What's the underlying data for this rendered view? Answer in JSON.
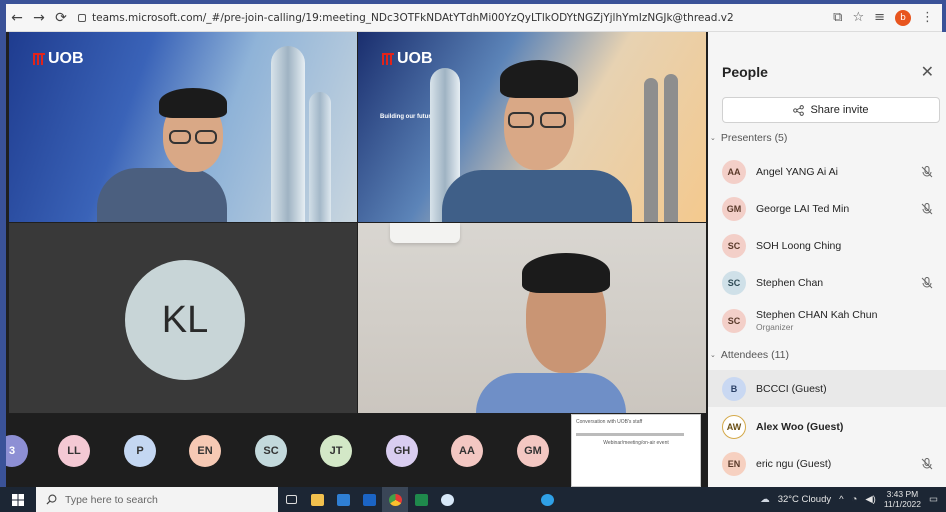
{
  "browser": {
    "url": "teams.microsoft.com/_#/pre-join-calling/19:meeting_NDc3OTFkNDAtYTdhMi00YzQyLTlkODYtNGZjYjlhYmIzNGJk@thread.v2",
    "profile_initial": "b"
  },
  "tiles": {
    "brand": "UOB",
    "caption_1": "Building our future together",
    "kl_initials": "KL"
  },
  "strip": {
    "avatars": [
      {
        "initials": "3",
        "color": "#8d8fd4"
      },
      {
        "initials": "LL",
        "color": "#f4c9d4"
      },
      {
        "initials": "P",
        "color": "#c4d7f2"
      },
      {
        "initials": "EN",
        "color": "#f6c9b4"
      },
      {
        "initials": "SC",
        "color": "#c3d9dc"
      },
      {
        "initials": "JT",
        "color": "#d3e8c7"
      },
      {
        "initials": "GH",
        "color": "#d9cdf0"
      },
      {
        "initials": "AA",
        "color": "#f3c7c2"
      },
      {
        "initials": "GM",
        "color": "#f3c7c2"
      }
    ],
    "preview_title": "Conversation with UOB's staff",
    "preview_body": "Webinar/meeting/on-air event"
  },
  "panel": {
    "title": "People",
    "share_label": "Share invite",
    "presenters_label": "Presenters (5)",
    "attendees_label": "Attendees (11)",
    "presenters": [
      {
        "initials": "AA",
        "name": "Angel YANG Ai Ai",
        "color": "#f3cfc8",
        "muted": true
      },
      {
        "initials": "GM",
        "name": "George LAI Ted Min",
        "color": "#f3cfc8",
        "muted": true
      },
      {
        "initials": "SC",
        "name": "SOH Loong Ching",
        "color": "#f3cfc8",
        "muted": false
      },
      {
        "initials": "SC",
        "name": "Stephen Chan",
        "color": "#cfe0e8",
        "muted": true
      },
      {
        "initials": "SC",
        "name": "Stephen CHAN Kah Chun",
        "sub": "Organizer",
        "color": "#f3cfc8",
        "muted": false
      }
    ],
    "attendees": [
      {
        "initials": "B",
        "name": "BCCCI (Guest)",
        "color": "#c9d8f2",
        "muted": false
      },
      {
        "initials": "AW",
        "name": "Alex Woo (Guest)",
        "color": "#ffffff",
        "muted": false
      },
      {
        "initials": "EN",
        "name": "eric ngu (Guest)",
        "color": "#f6d0c0",
        "muted": true
      }
    ]
  },
  "taskbar": {
    "search_placeholder": "Type here to search",
    "weather": "32°C  Cloudy",
    "time": "3:43 PM",
    "date": "11/1/2022"
  }
}
